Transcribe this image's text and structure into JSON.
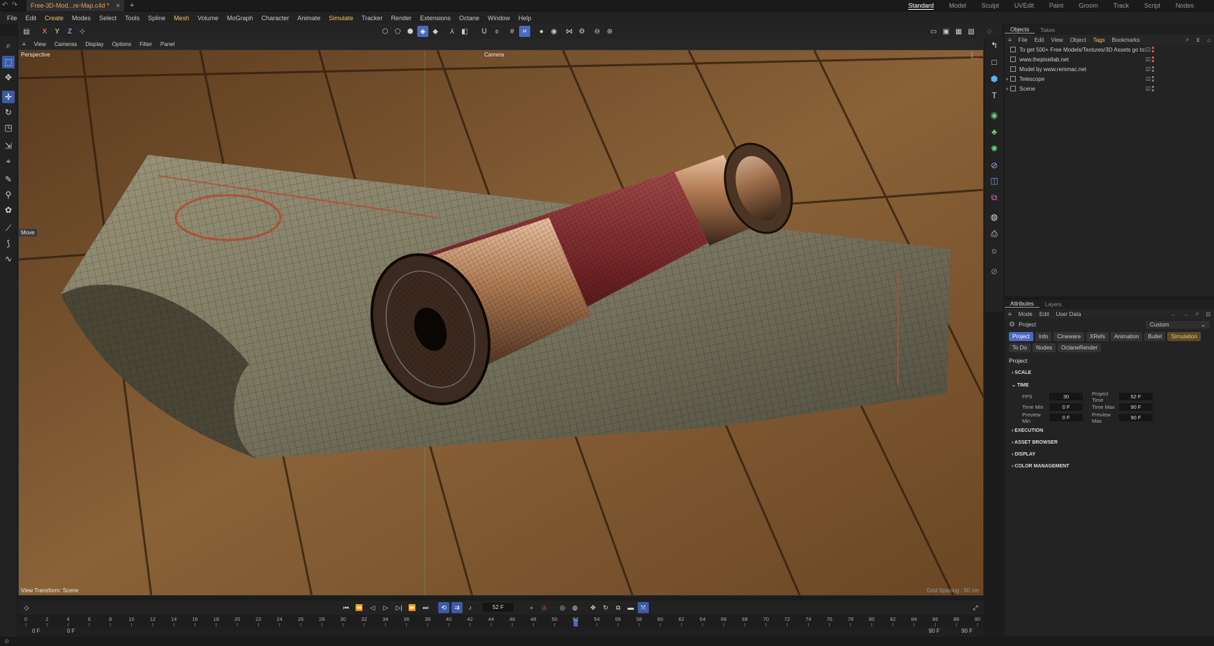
{
  "tab": {
    "title": "Free-3D-Mod...re-Map.c4d *",
    "close": "×",
    "new": "+"
  },
  "layouts": [
    "Standard",
    "Model",
    "Sculpt",
    "UVEdit",
    "Paint",
    "Groom",
    "Track",
    "Script",
    "Nodes"
  ],
  "menu": [
    "File",
    "Edit",
    "Create",
    "Modes",
    "Select",
    "Tools",
    "Spline",
    "Mesh",
    "Volume",
    "MoGraph",
    "Character",
    "Animate",
    "Simulate",
    "Tracker",
    "Render",
    "Extensions",
    "Octane",
    "Window",
    "Help"
  ],
  "axes": {
    "x": "X",
    "y": "Y",
    "z": "Z"
  },
  "viewport": {
    "menu": [
      "View",
      "Cameras",
      "Display",
      "Options",
      "Filter",
      "Panel"
    ],
    "label": "Perspective",
    "camera": "Camera",
    "tool_hint": "Move",
    "view_transform": "View Transform: Scene",
    "grid_spacing": "Grid Spacing : 50 cm"
  },
  "objects_panel": {
    "tabs": [
      "Objects",
      "Takes"
    ],
    "menu": [
      "File",
      "Edit",
      "View",
      "Object",
      "Tags",
      "Bookmarks"
    ],
    "items": [
      {
        "name": "To get 500+ Free Models/Textures/3D Assets go to:"
      },
      {
        "name": "www.thepixellab.net"
      },
      {
        "name": "Model by www.remmac.net"
      },
      {
        "name": "Telescope"
      },
      {
        "name": "Scene"
      }
    ]
  },
  "attributes_panel": {
    "tabs": [
      "Attributes",
      "Layers"
    ],
    "menu": [
      "Mode",
      "Edit",
      "User Data"
    ],
    "object": "Project",
    "preset": "Custom",
    "buttons": [
      "Project",
      "Info",
      "Cineware",
      "XRefs",
      "Animation",
      "Bullet",
      "Simulation",
      "To Do",
      "Nodes",
      "OctaneRender"
    ],
    "heading": "Project",
    "sections": {
      "scale": "SCALE",
      "time": "TIME",
      "execution": "EXECUTION",
      "asset_browser": "ASSET BROWSER",
      "display": "DISPLAY",
      "color_management": "COLOR MANAGEMENT"
    },
    "time": {
      "fps_label": "FPS",
      "fps": "30",
      "project_time_label": "Project Time",
      "project_time": "52 F",
      "time_min_label": "Time Min",
      "time_min": "0 F",
      "time_max_label": "Time Max",
      "time_max": "90 F",
      "preview_min_label": "Preview Min",
      "preview_min": "0 F",
      "preview_max_label": "Preview Max",
      "preview_max": "90 F"
    }
  },
  "timeline": {
    "current_frame": "52 F",
    "current_frame_value": 52,
    "ticks": [
      "0",
      "2",
      "4",
      "6",
      "8",
      "10",
      "12",
      "14",
      "16",
      "18",
      "20",
      "22",
      "24",
      "26",
      "28",
      "30",
      "32",
      "34",
      "36",
      "38",
      "40",
      "42",
      "44",
      "46",
      "48",
      "50",
      "52",
      "54",
      "56",
      "58",
      "60",
      "62",
      "64",
      "66",
      "68",
      "70",
      "72",
      "74",
      "76",
      "78",
      "80",
      "82",
      "84",
      "86",
      "88",
      "90"
    ],
    "start": "0 F",
    "start2": "0 F",
    "end": "90 F",
    "end2": "90 F"
  },
  "colors": {
    "accent": "#4b6ac0",
    "highlight": "#f2c060",
    "wood": "#7a5430",
    "copper": "#c88a5a",
    "leather": "#6e1f22"
  }
}
